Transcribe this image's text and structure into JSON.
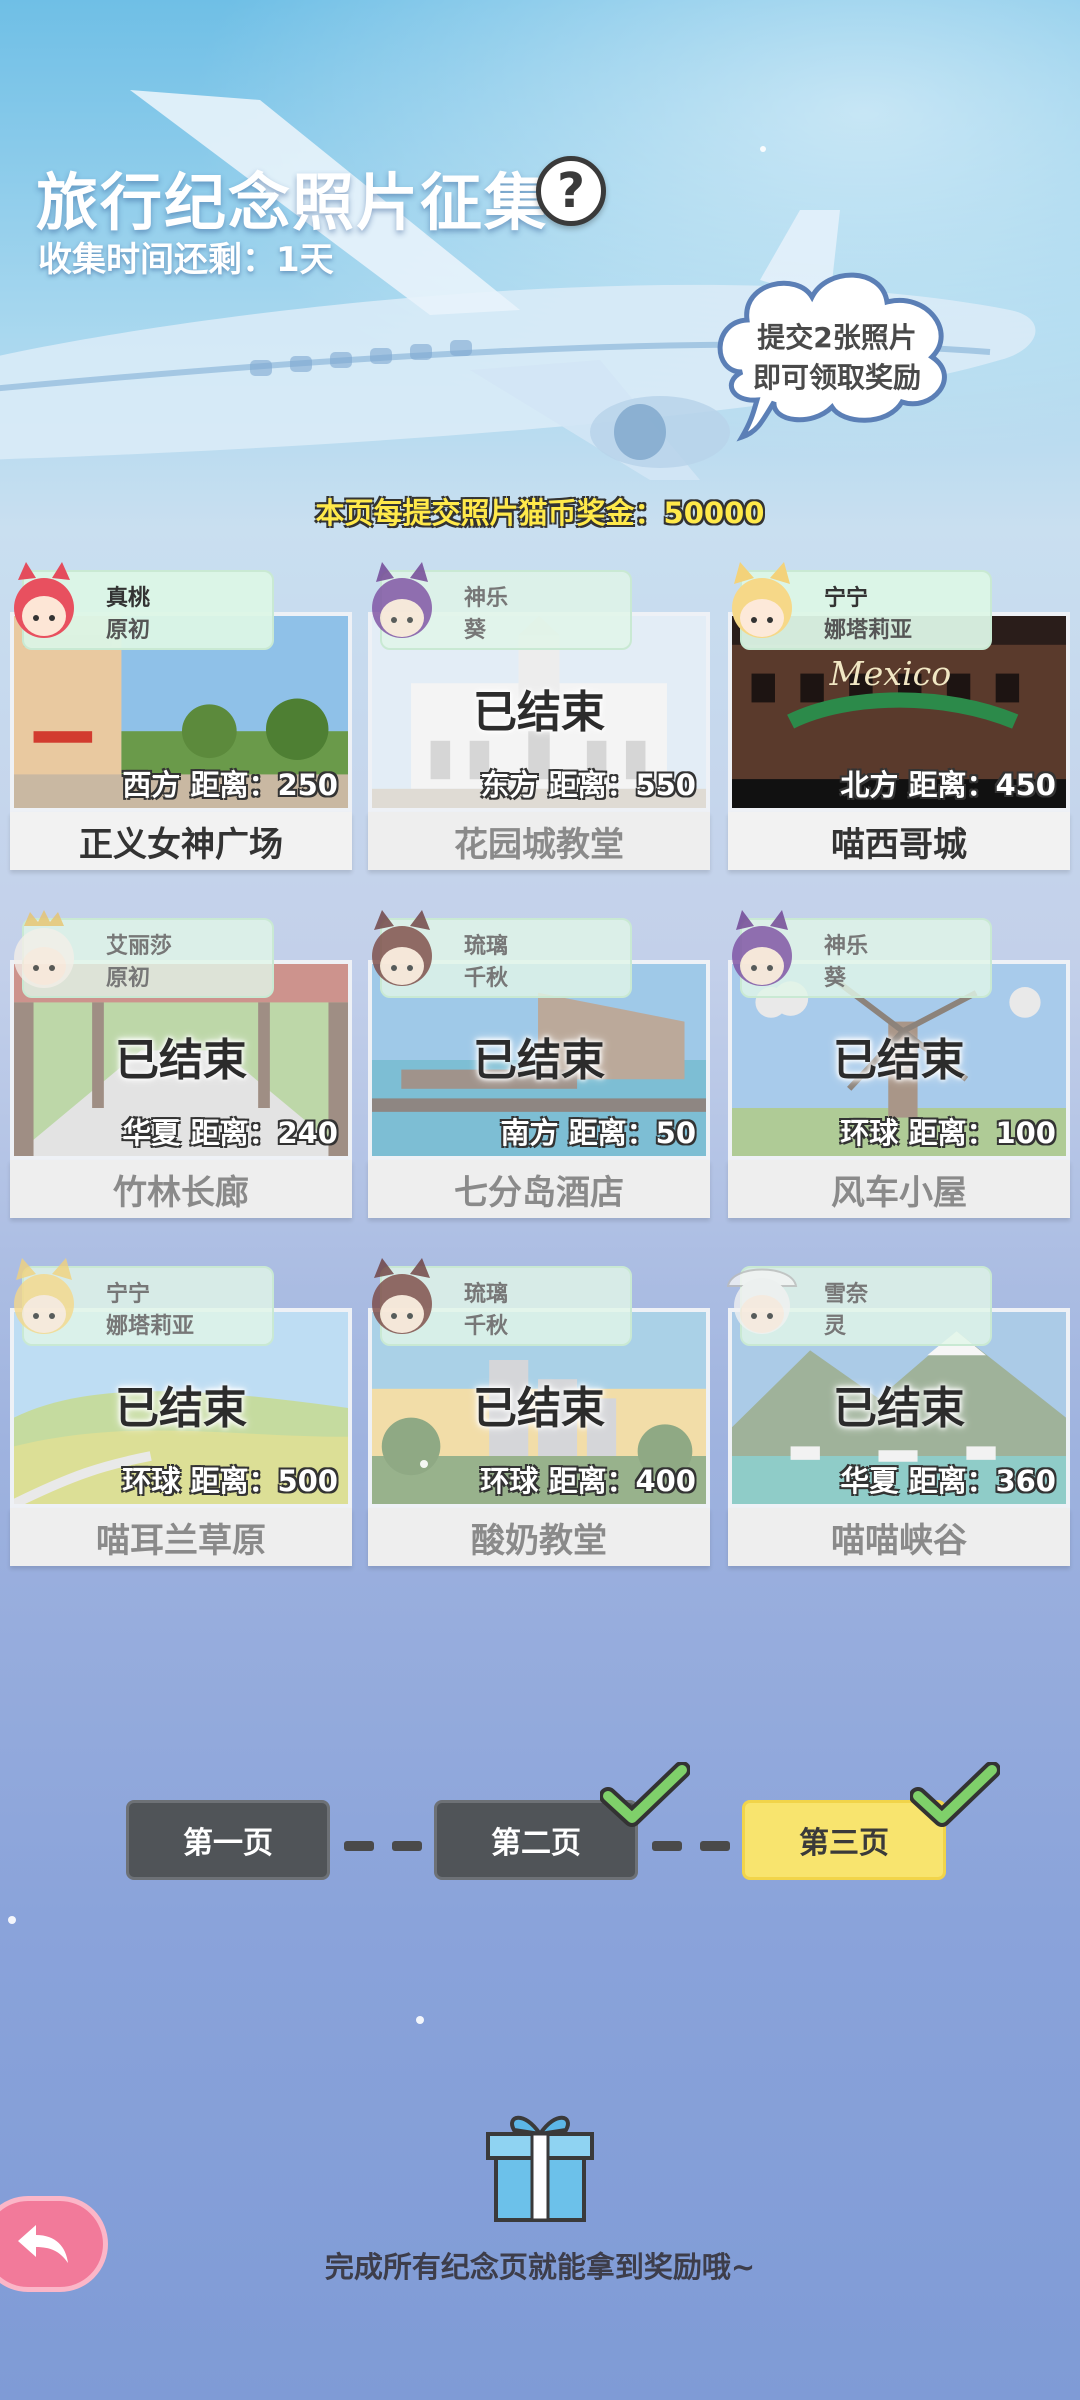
{
  "header": {
    "title": "旅行纪念照片征集",
    "help_icon": "?",
    "time_label": "收集时间还剩：",
    "time_value": "1天"
  },
  "cloud": {
    "line1": "提交2张照片",
    "line2": "即可领取奖励"
  },
  "bonus_text": "本页每提交照片猫币奖金：50000",
  "cards": [
    {
      "title": "正义女神广场",
      "distance": "西方  距离：250",
      "ended": "",
      "char_name": "真桃",
      "char_sub": "原初",
      "status": "open"
    },
    {
      "title": "花园城教堂",
      "distance": "东方  距离：550",
      "ended": "已结束",
      "char_name": "神乐",
      "char_sub": "葵",
      "status": "done"
    },
    {
      "title": "喵西哥城",
      "distance": "北方  距离：450",
      "ended": "",
      "char_name": "宁宁",
      "char_sub": "娜塔莉亚",
      "status": "open"
    },
    {
      "title": "竹林长廊",
      "distance": "华夏  距离：240",
      "ended": "已结束",
      "char_name": "艾丽莎",
      "char_sub": "原初",
      "status": "done"
    },
    {
      "title": "七分岛酒店",
      "distance": "南方  距离：50",
      "ended": "已结束",
      "char_name": "琉璃",
      "char_sub": "千秋",
      "status": "done"
    },
    {
      "title": "风车小屋",
      "distance": "环球  距离：100",
      "ended": "已结束",
      "char_name": "神乐",
      "char_sub": "葵",
      "status": "done"
    },
    {
      "title": "喵耳兰草原",
      "distance": "环球  距离：500",
      "ended": "已结束",
      "char_name": "宁宁",
      "char_sub": "娜塔莉亚",
      "status": "done"
    },
    {
      "title": "酸奶教堂",
      "distance": "环球  距离：400",
      "ended": "已结束",
      "char_name": "琉璃",
      "char_sub": "千秋",
      "status": "done"
    },
    {
      "title": "喵喵峡谷",
      "distance": "华夏  距离：360",
      "ended": "已结束",
      "char_name": "雪奈",
      "char_sub": "灵",
      "status": "done"
    }
  ],
  "photo_sign_text": "Mexico",
  "pager": {
    "pages": [
      {
        "label": "第一页",
        "completed": false,
        "active": false
      },
      {
        "label": "第二页",
        "completed": true,
        "active": false
      },
      {
        "label": "第三页",
        "completed": true,
        "active": true
      }
    ]
  },
  "footer": {
    "reward_text": "完成所有纪念页就能拿到奖励哦~"
  },
  "icons": {
    "help": "question-mark-icon",
    "check": "checkmark-icon",
    "gift": "gift-box-icon",
    "back": "back-arrow-icon"
  },
  "colors": {
    "active_page": "#f8e46e",
    "inactive_page": "#505458",
    "check": "#7fd06a",
    "back_button": "#f27a9a",
    "bonus_text": "#ffe94a"
  }
}
